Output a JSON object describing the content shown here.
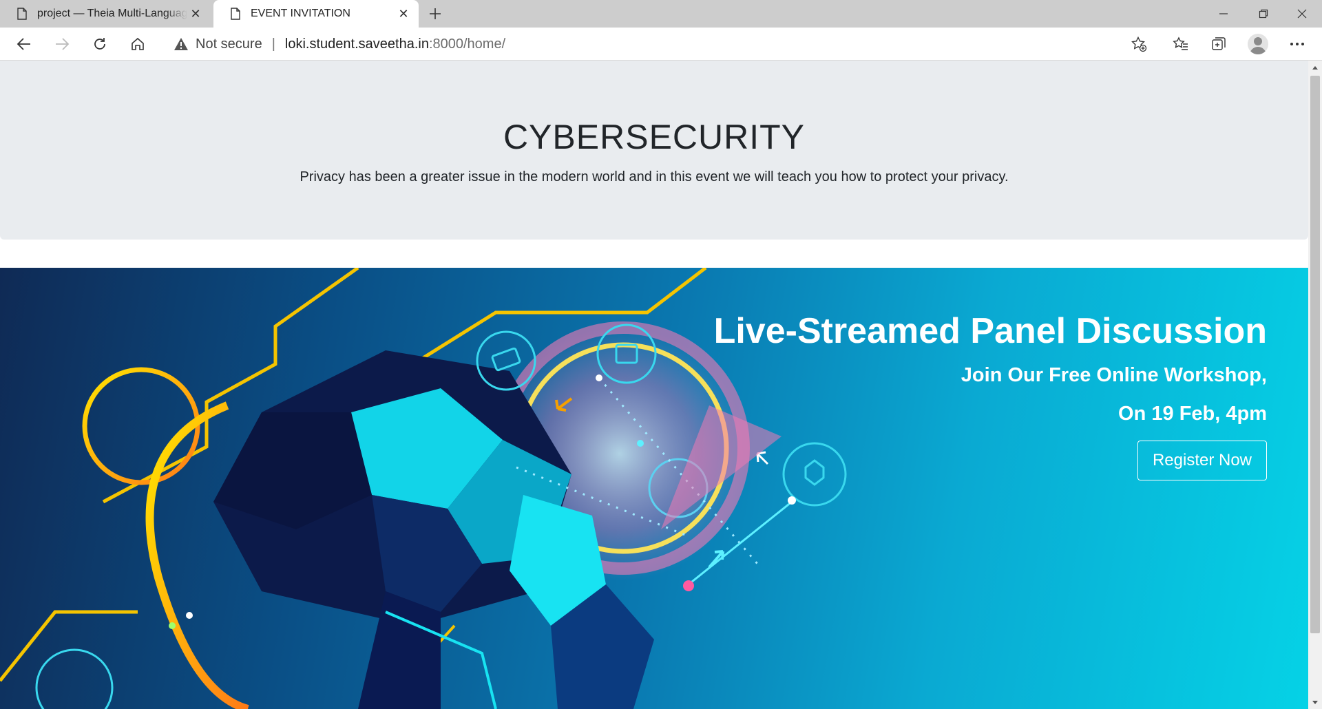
{
  "browser": {
    "tabs": [
      {
        "title": "project — Theia Multi-Language",
        "active": false
      },
      {
        "title": "EVENT INVITATION",
        "active": true
      }
    ],
    "address_bar": {
      "security_label": "Not secure",
      "separator": "|",
      "url_host": "loki.student.saveetha.in",
      "url_rest": ":8000/home/"
    },
    "icons": [
      "back-icon",
      "forward-icon",
      "reload-icon",
      "home-icon",
      "add-favorite-icon",
      "favorites-icon",
      "collections-icon",
      "profile-icon",
      "more-icon"
    ]
  },
  "jumbotron": {
    "title": "CYBERSECURITY",
    "description": "Privacy has been a greater issue in the modern world and in this event we will teach you how to protect your privacy."
  },
  "banner": {
    "heading": "Live-Streamed Panel Discussion",
    "subheading": "Join Our Free Online Workshop,",
    "date_line": "On 19 Feb, 4pm",
    "cta_label": "Register Now"
  },
  "colors": {
    "banner_start": "#0f2a55",
    "banner_end": "#05d2e6",
    "jumbotron_bg": "#e9ecef",
    "accent_yellow": "#f5c400",
    "accent_pink": "#f07ab5"
  }
}
